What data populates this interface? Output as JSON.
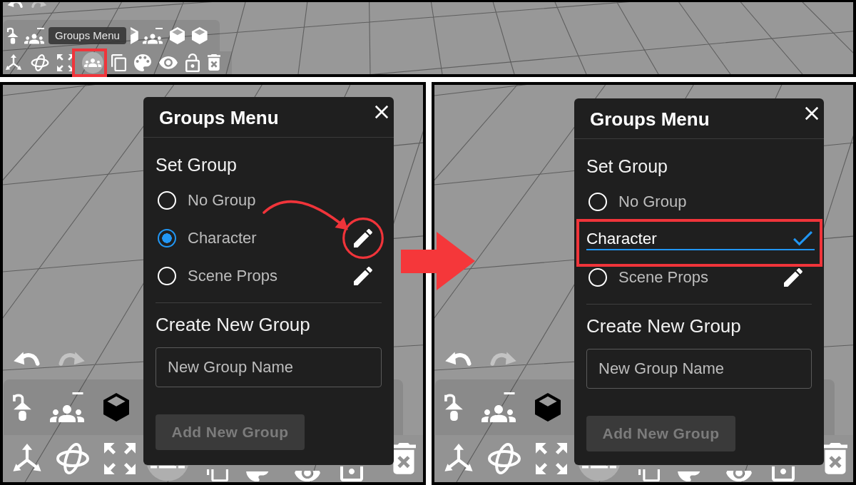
{
  "overview": {
    "history": [
      {
        "kind": "undo",
        "disabled": false
      },
      {
        "kind": "redo",
        "disabled": true
      }
    ],
    "tooltip": "Groups Menu",
    "groups_tool": {
      "active": true,
      "highlighted": true
    }
  },
  "steps": [
    {
      "history": [
        {
          "kind": "undo",
          "disabled": false
        },
        {
          "kind": "redo",
          "disabled": true
        }
      ],
      "groups_tool": {
        "active": true
      },
      "menu": {
        "title": "Groups Menu",
        "section_title": "Set Group",
        "groups": [
          {
            "kind": "radio",
            "label": "No Group",
            "selected": false,
            "editable": false,
            "highlighted": false
          },
          {
            "kind": "radio",
            "label": "Character",
            "selected": true,
            "editable": true,
            "highlighted": true
          },
          {
            "kind": "radio",
            "label": "Scene Props",
            "selected": false,
            "editable": true,
            "highlighted": false
          }
        ],
        "create_title": "Create New Group",
        "name_field": {
          "placeholder": "New Group Name"
        },
        "add_button": {
          "label": "Add New Group",
          "disabled": true
        }
      }
    },
    {
      "history": [
        {
          "kind": "undo",
          "disabled": false
        },
        {
          "kind": "redo",
          "disabled": true
        }
      ],
      "groups_tool": {
        "active": true
      },
      "menu": {
        "title": "Groups Menu",
        "section_title": "Set Group",
        "groups": [
          {
            "kind": "radio",
            "label": "No Group",
            "selected": false,
            "editable": false,
            "highlighted": false
          },
          {
            "kind": "editing",
            "value": "Character",
            "highlighted": true
          },
          {
            "kind": "radio",
            "label": "Scene Props",
            "selected": false,
            "editable": true,
            "highlighted": false
          }
        ],
        "create_title": "Create New Group",
        "name_field": {
          "placeholder": "New Group Name"
        },
        "add_button": {
          "label": "Add New Group",
          "disabled": true
        }
      }
    }
  ]
}
